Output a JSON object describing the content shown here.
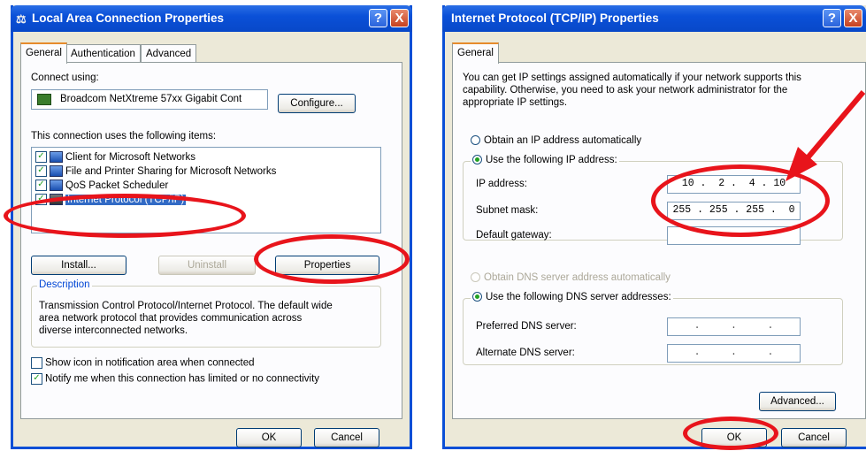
{
  "dialog1": {
    "title": "Local Area Connection Properties",
    "tabs": [
      "General",
      "Authentication",
      "Advanced"
    ],
    "connect_using_label": "Connect using:",
    "adapter_name": "Broadcom NetXtreme 57xx Gigabit Cont",
    "configure_button": "Configure...",
    "items_label": "This connection uses the following items:",
    "items": [
      {
        "label": "Client for Microsoft Networks",
        "checked": true
      },
      {
        "label": "File and Printer Sharing for Microsoft Networks",
        "checked": true
      },
      {
        "label": "QoS Packet Scheduler",
        "checked": true
      },
      {
        "label": "Internet Protocol (TCP/IP)",
        "checked": true,
        "selected": true
      }
    ],
    "install_button": "Install...",
    "uninstall_button": "Uninstall",
    "properties_button": "Properties",
    "description_legend": "Description",
    "description_text_1": "Transmission Control Protocol/Internet Protocol. The default wide",
    "description_text_2": "area network protocol that provides communication across",
    "description_text_3": "diverse interconnected networks.",
    "show_icon_label": "Show icon in notification area when connected",
    "notify_label": "Notify me when this connection has limited or no connectivity",
    "ok_button": "OK",
    "cancel_button": "Cancel"
  },
  "dialog2": {
    "title": "Internet Protocol (TCP/IP) Properties",
    "tabs": [
      "General"
    ],
    "intro_1": "You can get IP settings assigned automatically if your network supports this",
    "intro_2": "capability. Otherwise, you need to ask your network administrator for the",
    "intro_3": "appropriate IP settings.",
    "obtain_ip_auto": "Obtain an IP address automatically",
    "use_following_ip": "Use the following IP address:",
    "ip_address_label": "IP address:",
    "ip_address_value": "10 .  2 .  4 . 10",
    "subnet_label": "Subnet mask:",
    "subnet_value": "255 . 255 . 255 .  0",
    "gateway_label": "Default gateway:",
    "gateway_value": "",
    "obtain_dns_auto": "Obtain DNS server address automatically",
    "use_following_dns": "Use the following DNS server addresses:",
    "preferred_dns_label": "Preferred DNS server:",
    "preferred_dns_value": ".     .     .",
    "alternate_dns_label": "Alternate DNS server:",
    "alternate_dns_value": ".     .     .",
    "advanced_button": "Advanced...",
    "ok_button": "OK",
    "cancel_button": "Cancel"
  },
  "titlebar_buttons": {
    "help": "?",
    "close": "X"
  },
  "colors": {
    "titlebar": "#0a50d8",
    "dialog_bg": "#ece9d8",
    "highlight": "#316ac5",
    "annotation": "#e8141b"
  }
}
